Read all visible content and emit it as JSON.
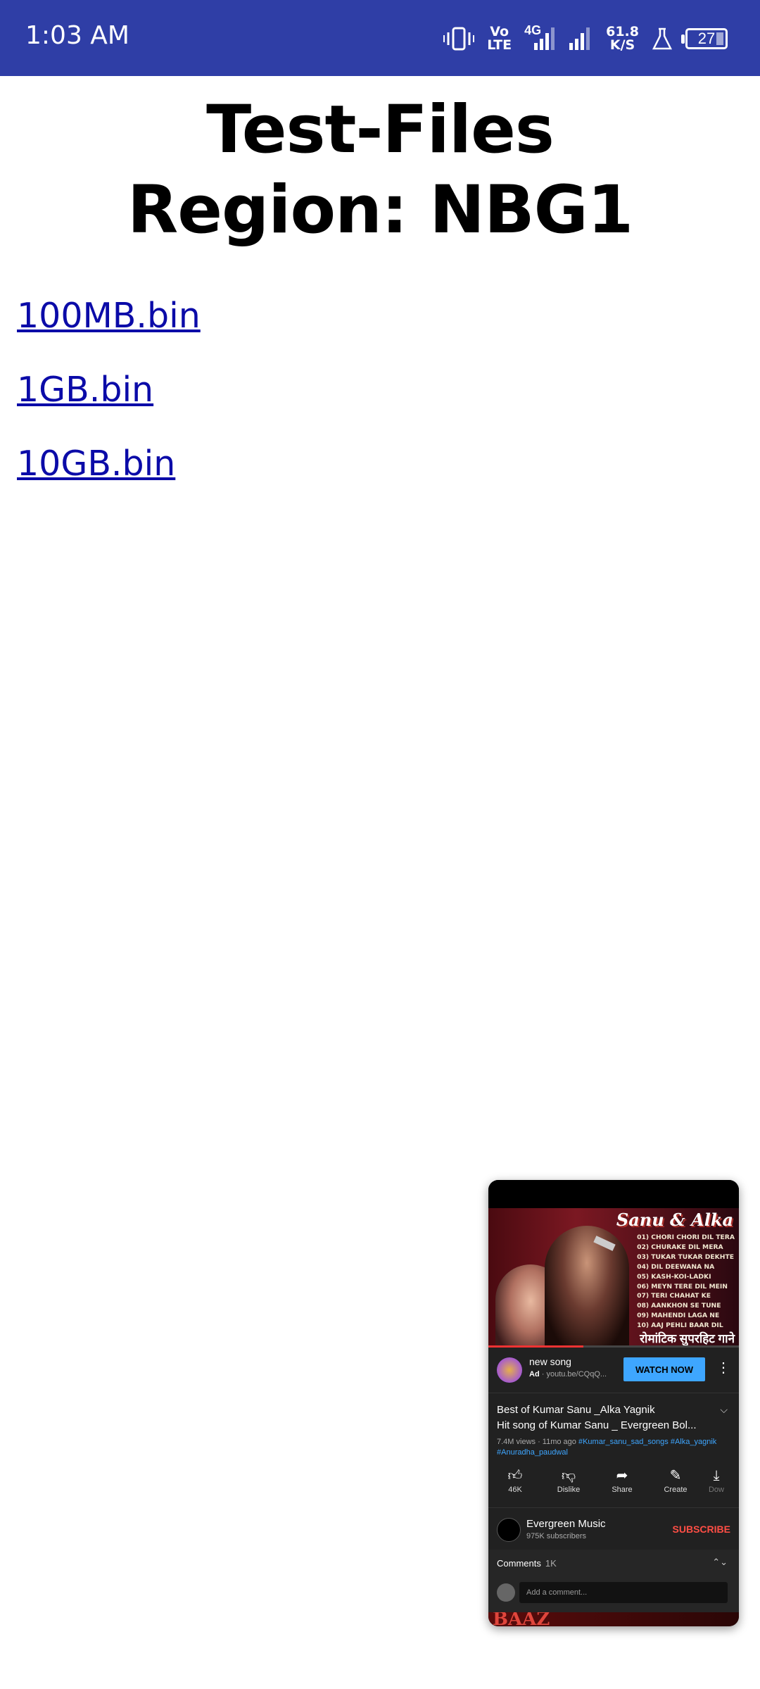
{
  "status_bar": {
    "time": "1:03 AM",
    "volte_top": "Vo",
    "volte_bottom": "LTE",
    "network": "4G",
    "speed_value": "61.8",
    "speed_unit": "K/S",
    "battery": "27",
    "icons": [
      "vibrate-icon",
      "volte-icon",
      "signal-icon",
      "signal-icon",
      "lab-icon",
      "battery-icon"
    ]
  },
  "page": {
    "title_line1": "Test-Files",
    "title_line2": "Region: NBG1",
    "links": [
      "100MB.bin",
      "1GB.bin",
      "10GB.bin"
    ],
    "link_color": "#0b0ba8"
  },
  "pip": {
    "thumbnail": {
      "heading": "Sanu & Alka",
      "tracks": [
        "01) CHORI CHORI DIL TERA",
        "02) CHURAKE DIL MERA",
        "03) TUKAR TUKAR DEKHTE",
        "04) DIL DEEWANA NA",
        "05) KASH-KOI-LADKI",
        "06) MEYN TERE DIL MEIN",
        "07) TERI CHAHAT KE",
        "08) AANKHON SE TUNE",
        "09) MAHENDI LAGA NE",
        "10) AAJ PEHLI BAAR DIL"
      ],
      "footer": "रोमांटिक सुपरहिट गाने"
    },
    "ad": {
      "title": "new song",
      "badge": "Ad",
      "url": "· youtu.be/CQqQ...",
      "cta": "WATCH NOW"
    },
    "video": {
      "title_line1": "Best of Kumar Sanu _Alka Yagnik",
      "title_line2": "Hit song of Kumar Sanu _ Evergreen Bol...",
      "meta": "7.4M views · 11mo ago",
      "tags": [
        "#Kumar_sanu_sad_songs",
        "#Alka_yagnik",
        "#Anuradha_paudwal"
      ]
    },
    "actions": [
      {
        "icon": "like-icon",
        "label": "46K"
      },
      {
        "icon": "dislike-icon",
        "label": "Dislike"
      },
      {
        "icon": "share-icon",
        "label": "Share"
      },
      {
        "icon": "create-icon",
        "label": "Create"
      },
      {
        "icon": "download-icon",
        "label": "Dow"
      }
    ],
    "channel": {
      "name": "Evergreen Music",
      "subscribers": "975K subscribers",
      "subscribe": "SUBSCRIBE"
    },
    "comments": {
      "label": "Comments",
      "count": "1K",
      "placeholder": "Add a comment..."
    },
    "next_preview": "BAAZ"
  }
}
